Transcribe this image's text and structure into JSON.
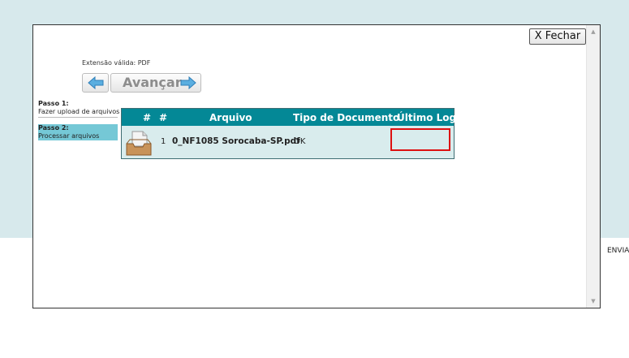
{
  "background": {
    "side_text": "ENVIA"
  },
  "modal": {
    "close_label": "X Fechar",
    "extension_label": "Extensão válida: PDF",
    "nav": {
      "next_label": "Avançar"
    },
    "steps": [
      {
        "title": "Passo 1:",
        "desc": "Fazer upload de arquivos"
      },
      {
        "title": "Passo 2:",
        "desc": "Processar arquivos"
      }
    ],
    "table": {
      "headers": [
        "#",
        "#",
        "Arquivo",
        "Tipo de Documento",
        "Último Log"
      ],
      "rows": [
        {
          "index": "1",
          "file": "0_NF1085 Sorocaba-SP.pdf",
          "doc_type": "OK",
          "last_log": ""
        }
      ]
    }
  },
  "colors": {
    "header": "#048896",
    "row": "#d9eced",
    "step_active": "#75c8d6",
    "highlight": "#dd1111",
    "page_bg": "#d7e9ec"
  }
}
